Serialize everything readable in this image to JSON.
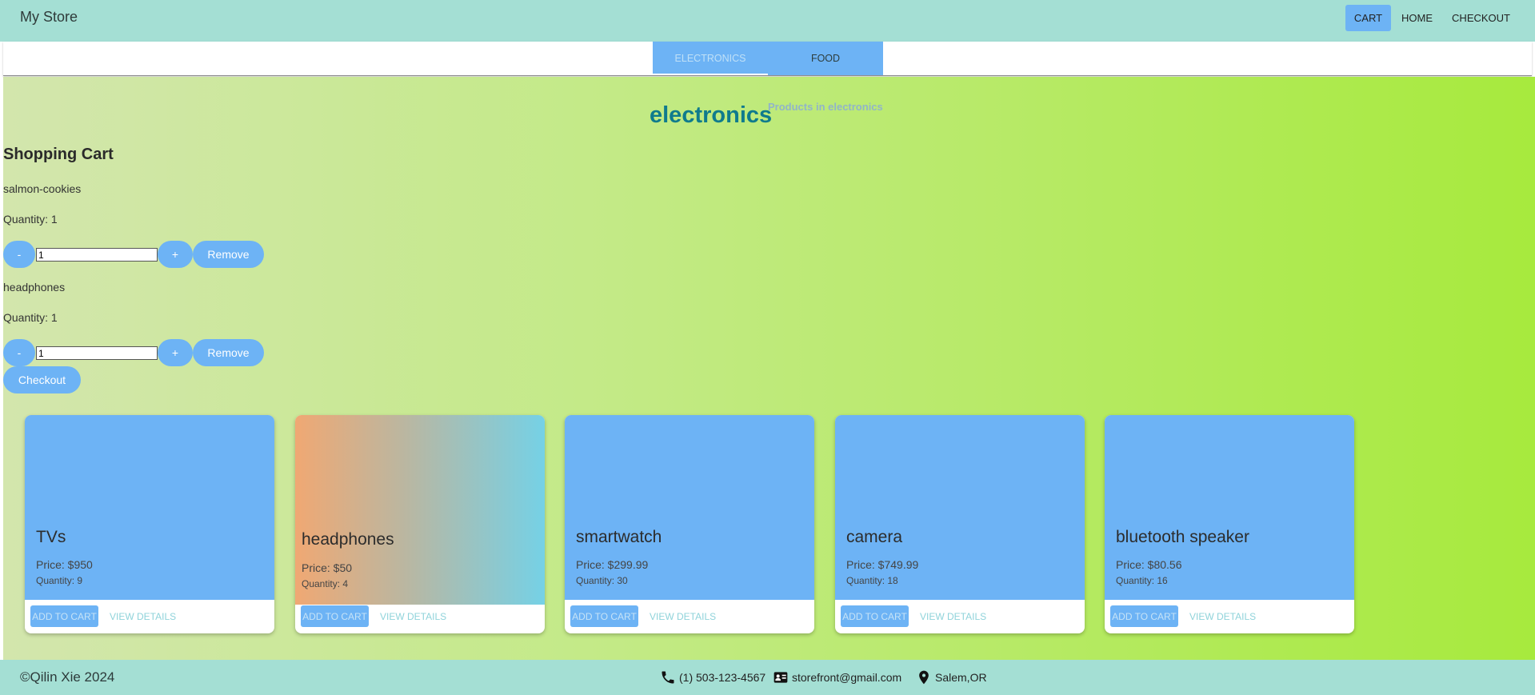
{
  "brand": "My Store",
  "nav": {
    "items": [
      "CART",
      "HOME",
      "CHECKOUT"
    ]
  },
  "tabs": [
    "ELECTRONICS",
    "FOOD"
  ],
  "category": {
    "title": "electronics",
    "subtitle": "Products in electronics"
  },
  "cart": {
    "heading": "Shopping Cart",
    "minus_label": "-",
    "plus_label": "+",
    "remove_label": "Remove",
    "checkout_label": "Checkout",
    "items": [
      {
        "name": "salmon-cookies",
        "quantity_text": "Quantity: 1",
        "quantity_value": "1"
      },
      {
        "name": "headphones",
        "quantity_text": "Quantity: 1",
        "quantity_value": "1"
      }
    ]
  },
  "products": [
    {
      "name": "TVs",
      "price": "Price: $950",
      "quantity": "Quantity: 9"
    },
    {
      "name": "headphones",
      "price": "Price: $50",
      "quantity": "Quantity: 4"
    },
    {
      "name": "smartwatch",
      "price": "Price: $299.99",
      "quantity": "Quantity: 30"
    },
    {
      "name": "camera",
      "price": "Price: $749.99",
      "quantity": "Quantity: 18"
    },
    {
      "name": "bluetooth speaker",
      "price": "Price: $80.56",
      "quantity": "Quantity: 16"
    }
  ],
  "product_actions": {
    "add": "ADD TO CART",
    "view": "VIEW DETAILS"
  },
  "footer": {
    "copyright": "©Qilin Xie 2024",
    "phone": "(1) 503-123-4567",
    "email": "storefront@gmail.com",
    "location": "Salem,OR",
    "icons": [
      "phone-icon",
      "contact-card-icon",
      "location-pin-icon"
    ]
  },
  "colors": {
    "appbar": "#a4dfd4",
    "accent": "#6db3f5",
    "category_title": "#0f7b8d",
    "gradient_start": "#d3e6ad",
    "gradient_end": "#a7ea3d"
  }
}
